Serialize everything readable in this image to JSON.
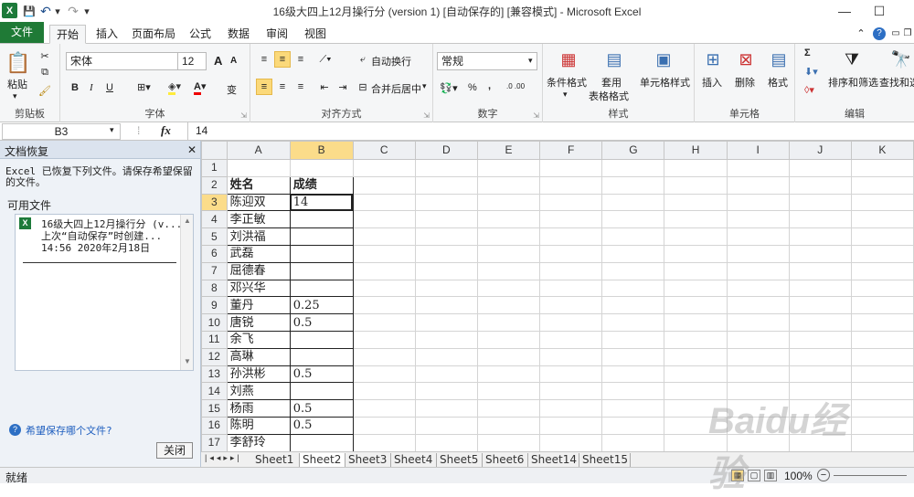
{
  "title": "16级大四上12月操行分 (version 1) [自动保存的]  [兼容模式]  -  Microsoft Excel",
  "quick_access": {
    "save": "💾",
    "undo": "↶",
    "redo": "↷",
    "more": "▾"
  },
  "window": {
    "help": "?",
    "min": "▭",
    "restore": "❐",
    "close": "✕"
  },
  "menu": {
    "file": "文件",
    "tabs": [
      "开始",
      "插入",
      "页面布局",
      "公式",
      "数据",
      "审阅",
      "视图"
    ]
  },
  "ribbon": {
    "clipboard": {
      "paste": "粘贴",
      "label": "剪贴板"
    },
    "font": {
      "name": "宋体",
      "size": "12",
      "bold": "B",
      "italic": "I",
      "underline": "U",
      "label": "字体",
      "grow": "A",
      "shrink": "A",
      "phonetic": "变"
    },
    "alignment": {
      "wrap": "自动换行",
      "merge": "合并后居中",
      "label": "对齐方式"
    },
    "number": {
      "format": "常规",
      "percent": "%",
      "comma": ",",
      "label": "数字",
      "inc": ".0 .00",
      "dec": ".00 .0"
    },
    "styles": {
      "conditional": "条件格式",
      "table1": "套用",
      "table2": "表格格式",
      "cell": "单元格样式",
      "label": "样式"
    },
    "cells": {
      "insert": "插入",
      "delete": "删除",
      "format": "格式",
      "label": "单元格"
    },
    "editing": {
      "sigma": "Σ",
      "sort": "排序和筛选",
      "find": "查找和选",
      "label": "编辑"
    }
  },
  "formula_bar": {
    "name_box": "B3",
    "fx": "fx",
    "value": "14"
  },
  "recovery": {
    "title": "文档恢复",
    "desc": "Excel 已恢复下列文件。请保存希望保留的文件。",
    "available": "可用文件",
    "file_name": "16级大四上12月操行分 (v...",
    "file_info": "上次“自动保存”时创建...",
    "file_time": "14:56 2020年2月18日",
    "help_link": "希望保存哪个文件?",
    "close": "关闭"
  },
  "columns": [
    "A",
    "B",
    "C",
    "D",
    "E",
    "F",
    "G",
    "H",
    "I",
    "J",
    "K"
  ],
  "rows": [
    {
      "n": "1",
      "a": "",
      "b": ""
    },
    {
      "n": "2",
      "a": "姓名",
      "b": "成绩"
    },
    {
      "n": "3",
      "a": "陈迎双",
      "b": "14"
    },
    {
      "n": "4",
      "a": "李正敏",
      "b": ""
    },
    {
      "n": "5",
      "a": "刘洪福",
      "b": ""
    },
    {
      "n": "6",
      "a": "武磊",
      "b": ""
    },
    {
      "n": "7",
      "a": "屈德春",
      "b": ""
    },
    {
      "n": "8",
      "a": "邓兴华",
      "b": ""
    },
    {
      "n": "9",
      "a": "董丹",
      "b": "0.25"
    },
    {
      "n": "10",
      "a": "唐锐",
      "b": "0.5"
    },
    {
      "n": "11",
      "a": "余飞",
      "b": ""
    },
    {
      "n": "12",
      "a": "高琳",
      "b": ""
    },
    {
      "n": "13",
      "a": "孙洪彬",
      "b": "0.5"
    },
    {
      "n": "14",
      "a": "刘燕",
      "b": ""
    },
    {
      "n": "15",
      "a": "杨雨",
      "b": "0.5"
    },
    {
      "n": "16",
      "a": "陈明",
      "b": "0.5"
    },
    {
      "n": "17",
      "a": "李舒玲",
      "b": ""
    }
  ],
  "sheets": [
    "Sheet1",
    "Sheet2",
    "Sheet3",
    "Sheet4",
    "Sheet5",
    "Sheet6",
    "Sheet14",
    "Sheet15"
  ],
  "status": {
    "ready": "就绪",
    "zoom": "100%"
  },
  "watermark": "Baidu经验"
}
